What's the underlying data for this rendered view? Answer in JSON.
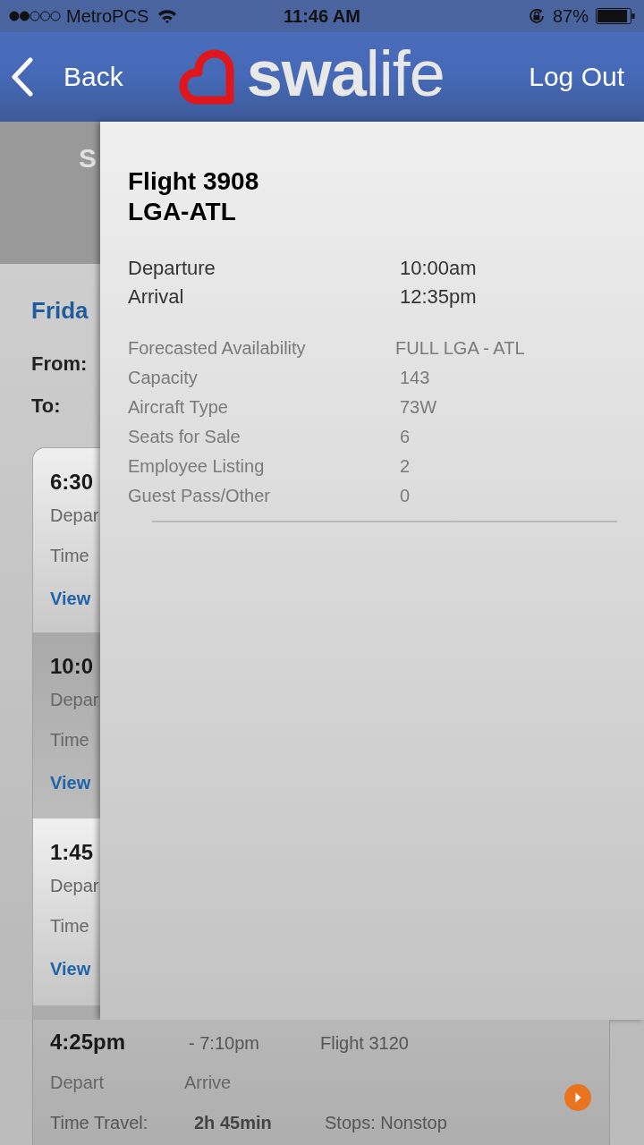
{
  "status_bar": {
    "carrier": "MetroPCS",
    "time": "11:46 AM",
    "battery": "87%"
  },
  "nav_bar": {
    "back": "Back",
    "logo": "**swa**life",
    "logout": "Log Out"
  },
  "background_page": {
    "title": "S",
    "date": "Frida",
    "from_label": "From:",
    "to_label": "To:",
    "cards": [
      {
        "time": "6:30",
        "depart": "Depar",
        "travel": "Time",
        "link": "View"
      },
      {
        "time": "10:0",
        "depart": "Depar",
        "travel": "Time",
        "link": "View"
      },
      {
        "time": "1:45",
        "depart": "Depar",
        "travel": "Time",
        "link": "View"
      }
    ]
  },
  "flight_detail": {
    "title": "Flight 3908",
    "route": "LGA-ATL",
    "times": [
      {
        "label": "Departure",
        "value": "10:00am"
      },
      {
        "label": "Arrival",
        "value": "12:35pm"
      }
    ],
    "details": [
      {
        "label": "Forecasted Availability",
        "value": "FULL LGA - ATL"
      },
      {
        "label": "Capacity",
        "value": "143"
      },
      {
        "label": "Aircraft Type",
        "value": "73W"
      },
      {
        "label": "Seats for Sale",
        "value": "6"
      },
      {
        "label": "Employee Listing",
        "value": "2"
      },
      {
        "label": "Guest Pass/Other",
        "value": "0"
      }
    ]
  },
  "bottom_card": {
    "depart_time": "4:25pm",
    "arrive_time": "- 7:10pm",
    "flight": "Flight 3120",
    "depart_label": "Depart",
    "arrive_label": "Arrive",
    "travel_label": "Time Travel:",
    "duration": "2h 45min",
    "stops": "Stops: Nonstop"
  }
}
